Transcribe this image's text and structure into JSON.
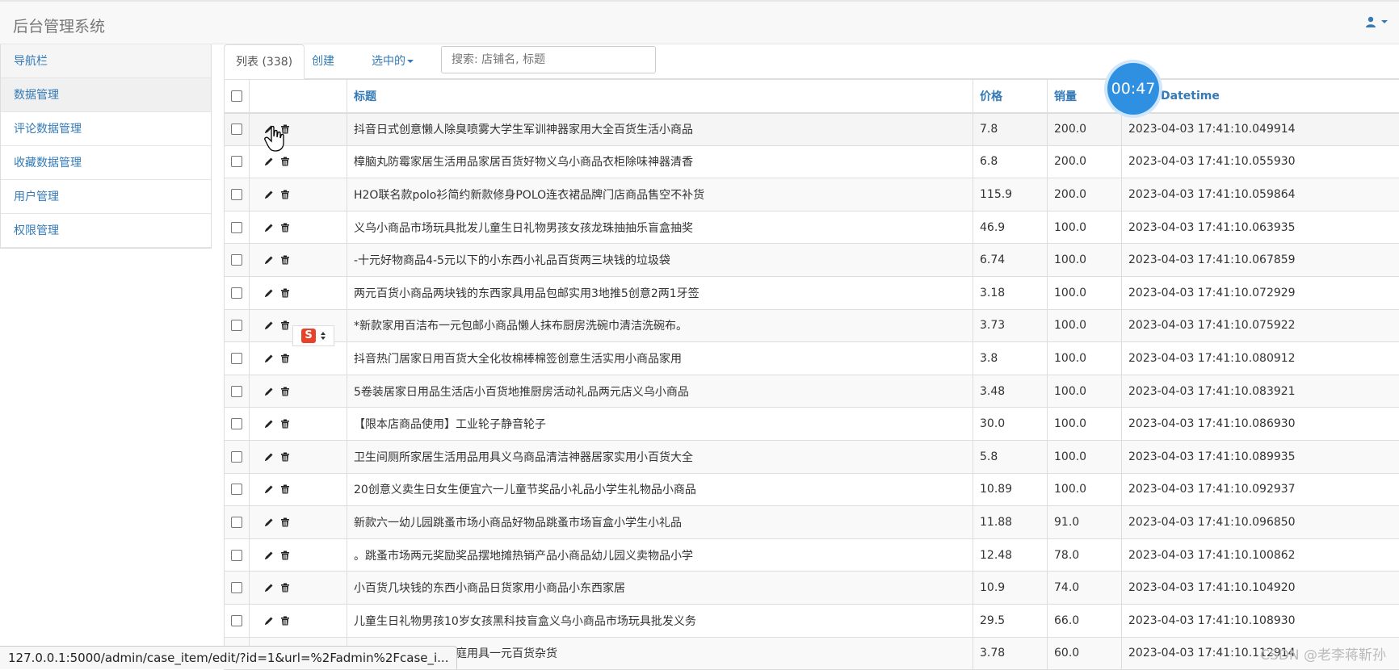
{
  "brand": "后台管理系统",
  "sidebar": {
    "items": [
      {
        "label": "导航栏"
      },
      {
        "label": "数据管理"
      },
      {
        "label": "评论数据管理"
      },
      {
        "label": "收藏数据管理"
      },
      {
        "label": "用户管理"
      },
      {
        "label": "权限管理"
      }
    ]
  },
  "tabs": {
    "list_label": "列表 (338)",
    "create_label": "创建",
    "selected_label": "选中的"
  },
  "search": {
    "placeholder": "搜索: 店铺名, 标题"
  },
  "table": {
    "headers": {
      "title": "标题",
      "price": "价格",
      "sales": "销量",
      "datetime": "Datetime"
    },
    "rows": [
      {
        "title": "抖音日式创意懒人除臭喷雾大学生军训神器家用大全百货生活小商品",
        "price": "7.8",
        "sales": "200.0",
        "datetime": "2023-04-03 17:41:10.049914"
      },
      {
        "title": "樟脑丸防霉家居生活用品家居百货好物义乌小商品衣柜除味神器清香",
        "price": "6.8",
        "sales": "200.0",
        "datetime": "2023-04-03 17:41:10.055930"
      },
      {
        "title": "H2O联名款polo衫简约新款修身POLO连衣裙品牌门店商品售空不补货",
        "price": "115.9",
        "sales": "200.0",
        "datetime": "2023-04-03 17:41:10.059864"
      },
      {
        "title": "义乌小商品市场玩具批发儿童生日礼物男孩女孩龙珠抽抽乐盲盒抽奖",
        "price": "46.9",
        "sales": "100.0",
        "datetime": "2023-04-03 17:41:10.063935"
      },
      {
        "title": "-十元好物商品4-5元以下的小东西小礼品百货两三块钱的垃圾袋",
        "price": "6.74",
        "sales": "100.0",
        "datetime": "2023-04-03 17:41:10.067859"
      },
      {
        "title": "两元百货小商品两块钱的东西家具用品包邮实用3地推5创意2两1牙签",
        "price": "3.18",
        "sales": "100.0",
        "datetime": "2023-04-03 17:41:10.072929"
      },
      {
        "title": "*新款家用百洁布一元包邮小商品懒人抹布厨房洗碗巾清洁洗碗布。",
        "price": "3.73",
        "sales": "100.0",
        "datetime": "2023-04-03 17:41:10.075922"
      },
      {
        "title": "抖音热门居家日用百货大全化妆棉棒棉签创意生活实用小商品家用",
        "price": "3.8",
        "sales": "100.0",
        "datetime": "2023-04-03 17:41:10.080912"
      },
      {
        "title": "5卷装居家日用品生活店小百货地推厨房活动礼品两元店义乌小商品",
        "price": "3.48",
        "sales": "100.0",
        "datetime": "2023-04-03 17:41:10.083921"
      },
      {
        "title": "【限本店商品使用】工业轮子静音轮子",
        "price": "30.0",
        "sales": "100.0",
        "datetime": "2023-04-03 17:41:10.086930"
      },
      {
        "title": "卫生间厕所家居生活用品用具义乌商品清洁神器居家实用小百货大全",
        "price": "5.8",
        "sales": "100.0",
        "datetime": "2023-04-03 17:41:10.089935"
      },
      {
        "title": "20创意义卖生日女生便宜六一儿童节奖品小礼品小学生礼物品小商品",
        "price": "10.89",
        "sales": "100.0",
        "datetime": "2023-04-03 17:41:10.092937"
      },
      {
        "title": "新款六一幼儿园跳蚤市场小商品好物品跳蚤市场盲盒小学生小礼品",
        "price": "11.88",
        "sales": "91.0",
        "datetime": "2023-04-03 17:41:10.096850"
      },
      {
        "title": "。跳蚤市场两元奖励奖品摆地摊热销产品小商品幼儿园义卖物品小学",
        "price": "12.48",
        "sales": "78.0",
        "datetime": "2023-04-03 17:41:10.100862"
      },
      {
        "title": "小百货几块钱的东西小商品日货家用小商品小东西家居",
        "price": "10.9",
        "sales": "74.0",
        "datetime": "2023-04-03 17:41:10.104920"
      },
      {
        "title": "儿童生日礼物男孩10岁女孩黑科技盲盒义乌小商品市场玩具批发义务",
        "price": "29.5",
        "sales": "66.0",
        "datetime": "2023-04-03 17:41:10.108930"
      },
      {
        "title": "厨房用品家用大全家庭用具一元百货杂货",
        "price": "3.78",
        "sales": "60.0",
        "datetime": "2023-04-03 17:41:10.112914"
      }
    ]
  },
  "timer": "00:47",
  "status_url": "127.0.0.1:5000/admin/case_item/edit/?id=1&url=%2Fadmin%2Fcase_i...",
  "watermark": "CSDN @老李蒋靳孙",
  "ime_glyph": "S",
  "colors": {
    "link": "#337ab7",
    "timer": "#2f8fe0",
    "ime": "#e8422a"
  }
}
